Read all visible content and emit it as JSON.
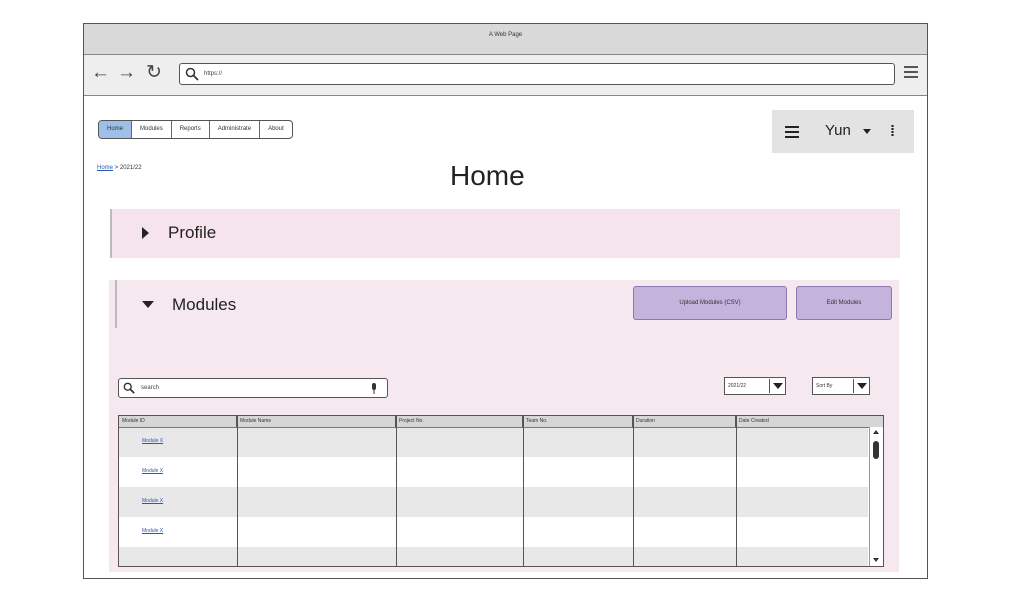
{
  "browser": {
    "title": "A Web Page",
    "url": "https://",
    "back_glyph": "←",
    "forward_glyph": "→",
    "reload_glyph": "↻"
  },
  "nav": {
    "tabs": [
      {
        "label": "Home",
        "active": true
      },
      {
        "label": "Modules",
        "active": false
      },
      {
        "label": "Reports",
        "active": false
      },
      {
        "label": "Administrate",
        "active": false
      },
      {
        "label": "About",
        "active": false
      }
    ]
  },
  "user": {
    "name": "Yun",
    "kebab_glyph": "⁞"
  },
  "breadcrumb": {
    "home": "Home",
    "separator": ">",
    "current": "2021/22"
  },
  "page": {
    "title": "Home"
  },
  "profile": {
    "label": "Profile"
  },
  "modules": {
    "label": "Modules",
    "upload_button": "Upload Modules (CSV)",
    "edit_button": "Edit Modules",
    "search_placeholder": "search",
    "year_select": "2021/22",
    "sort_select": "Sort By",
    "columns": [
      "Module ID",
      "Module Name",
      "Project No.",
      "Team No.",
      "Duration",
      "Date Created"
    ],
    "rows": [
      {
        "module_id": "Module X"
      },
      {
        "module_id": "Module X"
      },
      {
        "module_id": "Module X"
      },
      {
        "module_id": "Module X"
      }
    ]
  },
  "colors": {
    "active_tab": "#9ec0e8",
    "panel_bg": "#f6e4ec",
    "button_purple": "#c3b3dd",
    "link_blue": "#2a5ab0"
  }
}
